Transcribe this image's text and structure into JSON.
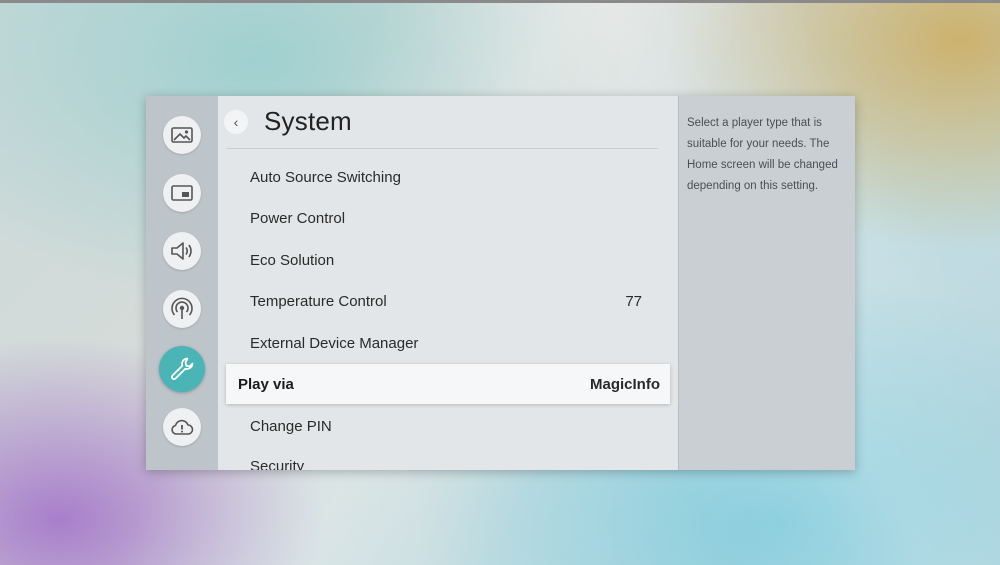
{
  "header": {
    "title": "System"
  },
  "menu": {
    "items": [
      {
        "label": "Auto Source Switching",
        "value": ""
      },
      {
        "label": "Power Control",
        "value": ""
      },
      {
        "label": "Eco Solution",
        "value": ""
      },
      {
        "label": "Temperature Control",
        "value": "77"
      },
      {
        "label": "External Device Manager",
        "value": ""
      },
      {
        "label": "Play via",
        "value": "MagicInfo",
        "selected": true
      },
      {
        "label": "Change PIN",
        "value": ""
      },
      {
        "label": "Security",
        "value": ""
      }
    ]
  },
  "sidebar": {
    "icons": [
      {
        "name": "picture-icon"
      },
      {
        "name": "onscreen-display-icon"
      },
      {
        "name": "sound-icon"
      },
      {
        "name": "network-icon"
      },
      {
        "name": "system-wrench-icon",
        "active": true
      },
      {
        "name": "support-cloud-icon"
      }
    ]
  },
  "description": {
    "text": "Select a player type that is suitable for your needs. The Home screen will be changed depending on this setting."
  },
  "colors": {
    "accent": "#4ab4b6",
    "sidebar": "#bdc5cb",
    "main": "#e3e6e8",
    "desc_panel": "#c9cfd3"
  }
}
